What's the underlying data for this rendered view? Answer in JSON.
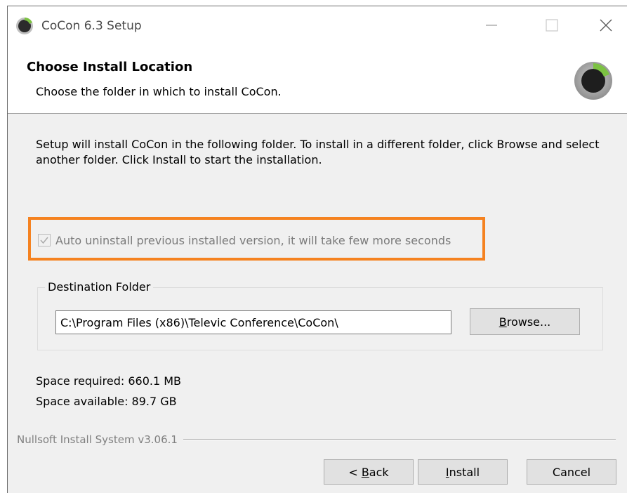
{
  "window": {
    "title": "CoCon 6.3 Setup",
    "controls": {
      "minimize": "minimize-icon",
      "maximize": "maximize-icon",
      "close": "close-icon"
    }
  },
  "header": {
    "title": "Choose Install Location",
    "subtitle": "Choose the folder in which to install CoCon."
  },
  "body": {
    "description": "Setup will install CoCon in the following folder. To install in a different folder, click Browse and select another folder. Click Install to start the installation.",
    "checkbox": {
      "label": "Auto uninstall previous installed version, it will take few more seconds",
      "checked": true,
      "disabled": true
    },
    "highlight_color": "#f58220",
    "destination": {
      "legend": "Destination Folder",
      "path": "C:\\Program Files (x86)\\Televic Conference\\CoCon\\",
      "browse_label": "Browse..."
    },
    "space_required": "Space required: 660.1 MB",
    "space_available": "Space available: 89.7 GB"
  },
  "footer": {
    "brand": "Nullsoft Install System v3.06.1",
    "back_label": "< Back",
    "install_label": "Install",
    "cancel_label": "Cancel"
  }
}
